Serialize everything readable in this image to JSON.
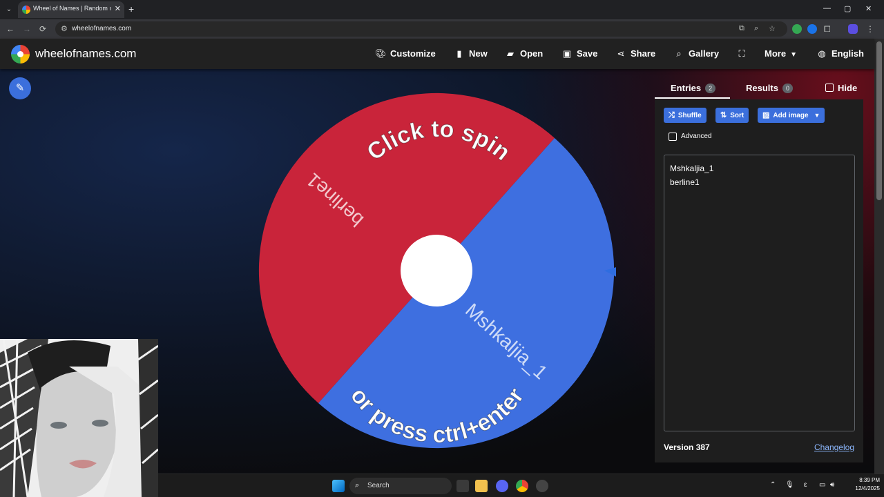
{
  "browser": {
    "tab_title": "Wheel of Names | Random name picker",
    "url": "wheelofnames.com",
    "new_tab": "+",
    "tab_close": "✕",
    "nav_back": "←",
    "nav_forward": "→",
    "nav_reload": "⟳",
    "min": "—",
    "max": "▢",
    "close": "✕"
  },
  "site": {
    "name": "wheelofnames.com",
    "menu": {
      "customize": "Customize",
      "new": "New",
      "open": "Open",
      "save": "Save",
      "share": "Share",
      "gallery": "Gallery",
      "more": "More",
      "language": "English"
    }
  },
  "wheel": {
    "spin_text_top": "Click to spin",
    "spin_text_bottom": "or press ctrl+enter",
    "colors": {
      "red": "#c9243a",
      "blue": "#3e6fe0",
      "center": "#ffffff"
    },
    "segments": [
      "berline1",
      "Mshkaljia_1"
    ]
  },
  "sidebar": {
    "tabs": {
      "entries_label": "Entries",
      "entries_count": "2",
      "results_label": "Results",
      "results_count": "0",
      "hide_label": "Hide"
    },
    "buttons": {
      "shuffle": "Shuffle",
      "sort": "Sort",
      "add_image": "Add image"
    },
    "advanced_label": "Advanced",
    "entries": [
      "Mshkaljia_1",
      "berline1"
    ],
    "version": "Version 387",
    "changelog": "Changelog"
  },
  "taskbar": {
    "search_placeholder": "Search",
    "time": "8:39 PM",
    "date": "12/4/2025",
    "lang": "ε"
  }
}
